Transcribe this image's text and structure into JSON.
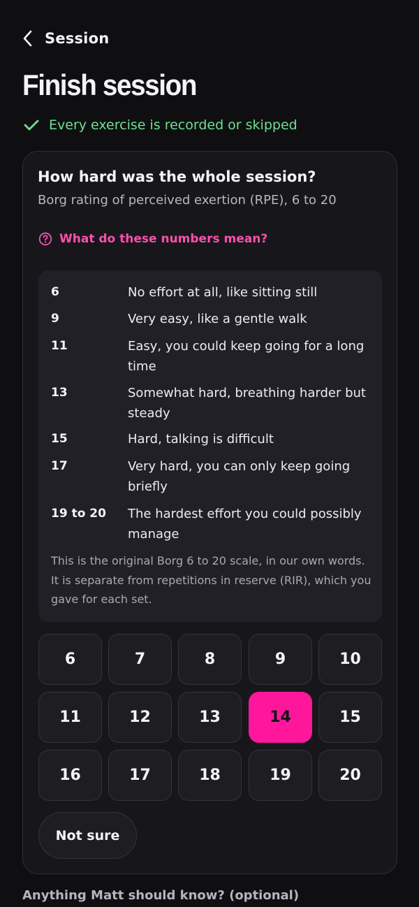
{
  "header": {
    "back_label": "Session"
  },
  "page_title": "Finish session",
  "status": {
    "text": "Every exercise is recorded or skipped",
    "color": "#6fe08e",
    "icon": "check-icon"
  },
  "card": {
    "title": "How hard was the whole session?",
    "subtitle": "Borg rating of perceived exertion (RPE), 6 to 20",
    "help_link": "What do these numbers mean?",
    "scale": [
      {
        "value": "6",
        "desc": "No effort at all, like sitting still"
      },
      {
        "value": "9",
        "desc": "Very easy, like a gentle walk"
      },
      {
        "value": "11",
        "desc": "Easy, you could keep going for a long time"
      },
      {
        "value": "13",
        "desc": "Somewhat hard, breathing harder but steady"
      },
      {
        "value": "15",
        "desc": "Hard, talking is difficult"
      },
      {
        "value": "17",
        "desc": "Very hard, you can only keep going briefly"
      },
      {
        "value": "19 to 20",
        "desc": "The hardest effort you could possibly manage"
      }
    ],
    "scale_note": "This is the original Borg 6 to 20 scale, in our own words. It is separate from repetitions in reserve (RIR), which you gave for each set.",
    "ratings": [
      "6",
      "7",
      "8",
      "9",
      "10",
      "11",
      "12",
      "13",
      "14",
      "15",
      "16",
      "17",
      "18",
      "19",
      "20"
    ],
    "selected_rating": "14",
    "not_sure_label": "Not sure"
  },
  "notes_label": "Anything Matt should know? (optional)",
  "colors": {
    "accent": "#ff179b",
    "link": "#ff4fae",
    "background": "#0f0f12",
    "card": "#17171b"
  }
}
